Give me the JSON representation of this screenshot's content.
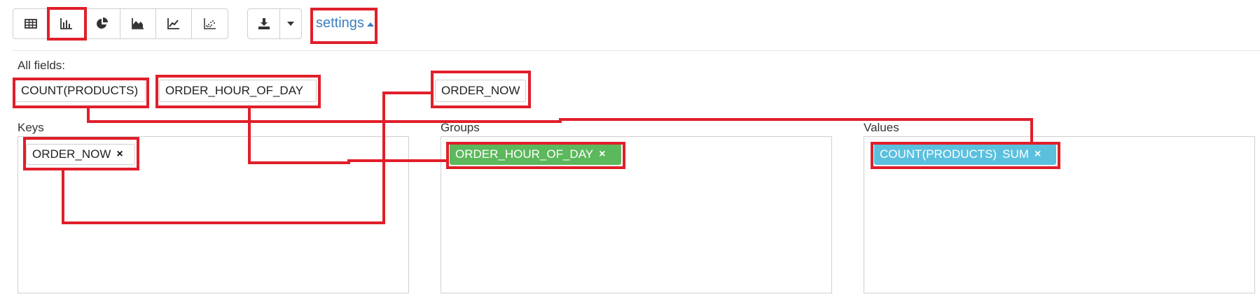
{
  "toolbar": {
    "view_buttons": [
      {
        "name": "table",
        "icon": "table-icon"
      },
      {
        "name": "bar-chart",
        "icon": "bar-chart-icon",
        "active": true
      },
      {
        "name": "pie-chart",
        "icon": "pie-chart-icon"
      },
      {
        "name": "area-chart",
        "icon": "area-chart-icon"
      },
      {
        "name": "line-chart",
        "icon": "line-chart-icon"
      },
      {
        "name": "scatter-chart",
        "icon": "scatter-chart-icon"
      }
    ],
    "download_icon": "download-icon",
    "dropdown_icon": "caret-down-icon",
    "settings_label": "settings"
  },
  "fields": {
    "label": "All fields:",
    "items": [
      "COUNT(PRODUCTS)",
      "ORDER_HOUR_OF_DAY",
      "ORDER_NOW"
    ]
  },
  "keys": {
    "label": "Keys",
    "chip": "ORDER_NOW",
    "remove_icon": "×"
  },
  "groups": {
    "label": "Groups",
    "chip": "ORDER_HOUR_OF_DAY",
    "remove_icon": "×"
  },
  "values": {
    "label": "Values",
    "chip": "COUNT(PRODUCTS)",
    "aggregation": "SUM",
    "remove_icon": "×"
  },
  "colors": {
    "accent": "#3a7fc1",
    "group_chip": "#5cb85c",
    "value_chip": "#5bc0de",
    "annotation": "#e01f2a"
  }
}
